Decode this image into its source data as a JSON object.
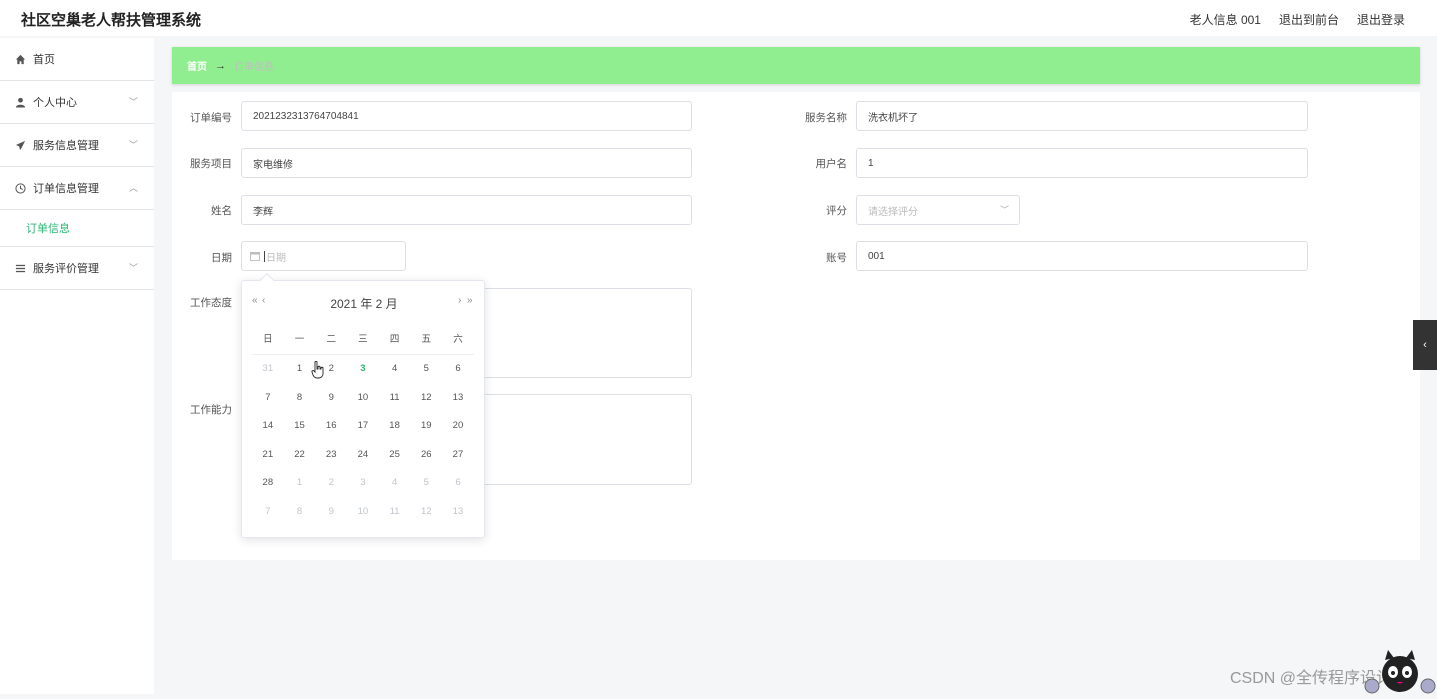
{
  "app": {
    "title": "社区空巢老人帮扶管理系统",
    "user_label": "老人信息 001",
    "front_label": "退出到前台",
    "logout_label": "退出登录"
  },
  "sidebar": {
    "items": [
      {
        "label": "首页",
        "icon": "home-icon"
      },
      {
        "label": "个人中心",
        "icon": "user-icon"
      },
      {
        "label": "服务信息管理",
        "icon": "send-icon"
      },
      {
        "label": "订单信息管理",
        "icon": "clock-icon"
      },
      {
        "label": "服务评价管理",
        "icon": "list-icon"
      }
    ],
    "sub_item": "订单信息"
  },
  "breadcrumb": {
    "home": "首页",
    "separator": "→",
    "current": "订单信息"
  },
  "form": {
    "order_no_label": "订单编号",
    "order_no_value": "2021232313764704841",
    "service_name_label": "服务名称",
    "service_name_value": "洗衣机坏了",
    "service_item_label": "服务项目",
    "service_item_value": "家电维修",
    "username_label": "用户名",
    "username_value": "1",
    "name_label": "姓名",
    "name_value": "李辉",
    "rating_label": "评分",
    "rating_placeholder": "请选择评分",
    "date_label": "日期",
    "date_placeholder": "日期",
    "account_label": "账号",
    "account_value": "001",
    "attitude_label": "工作态度",
    "ability_label": "工作能力"
  },
  "datepicker": {
    "header": "2021 年  2 月",
    "weekdays": [
      "日",
      "一",
      "二",
      "三",
      "四",
      "五",
      "六"
    ],
    "rows": [
      [
        "31",
        "1",
        "2",
        "3",
        "4",
        "5",
        "6"
      ],
      [
        "7",
        "8",
        "9",
        "10",
        "11",
        "12",
        "13"
      ],
      [
        "14",
        "15",
        "16",
        "17",
        "18",
        "19",
        "20"
      ],
      [
        "21",
        "22",
        "23",
        "24",
        "25",
        "26",
        "27"
      ],
      [
        "28",
        "1",
        "2",
        "3",
        "4",
        "5",
        "6"
      ],
      [
        "7",
        "8",
        "9",
        "10",
        "11",
        "12",
        "13"
      ]
    ],
    "today": "3"
  },
  "watermark": "CSDN @全传程序设计"
}
